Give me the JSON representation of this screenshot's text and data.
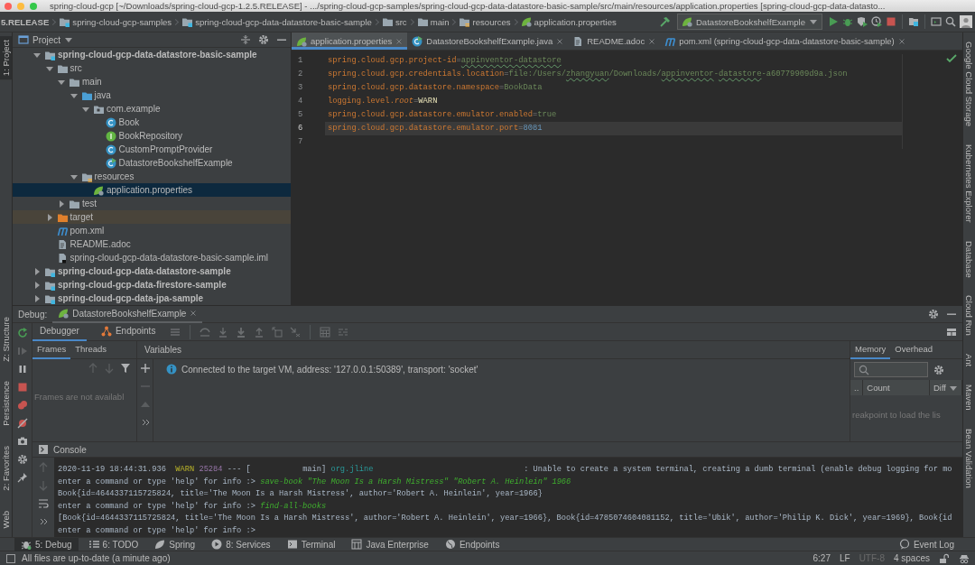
{
  "window": {
    "title": "spring-cloud-gcp [~/Downloads/spring-cloud-gcp-1.2.5.RELEASE] - .../spring-cloud-gcp-samples/spring-cloud-gcp-data-datastore-basic-sample/src/main/resources/application.properties [spring-cloud-gcp-data-datasto..."
  },
  "breadcrumbs": [
    "5.RELEASE",
    "spring-cloud-gcp-samples",
    "spring-cloud-gcp-data-datastore-basic-sample",
    "src",
    "main",
    "resources",
    "application.properties"
  ],
  "run_config": {
    "label": "DatastoreBookshelfExample"
  },
  "left_tool_windows": {
    "top": [
      {
        "label": "1: Project",
        "selected": true
      }
    ],
    "bottom": [
      {
        "label": "Z: Structure",
        "selected": false
      },
      {
        "label": "Persistence",
        "selected": false
      },
      {
        "label": "2: Favorites",
        "selected": false
      },
      {
        "label": "Web",
        "selected": false
      }
    ]
  },
  "right_tool_windows": [
    "Google Cloud Storage",
    "Kubernetes Explorer",
    "Database",
    "Cloud Run",
    "Ant",
    "Maven",
    "Bean Validation"
  ],
  "project_panel": {
    "title": "Project",
    "tree": [
      {
        "label": "spring-cloud-gcp-data-datastore-basic-sample",
        "kind": "module",
        "expanded": true,
        "selected": false,
        "children": [
          {
            "label": "src",
            "kind": "folder",
            "expanded": true,
            "selected": false,
            "children": [
              {
                "label": "main",
                "kind": "folder",
                "expanded": true,
                "selected": false,
                "children": [
                  {
                    "label": "java",
                    "kind": "source",
                    "expanded": true,
                    "selected": false,
                    "children": [
                      {
                        "label": "com.example",
                        "kind": "package",
                        "expanded": true,
                        "selected": false,
                        "children": [
                          {
                            "label": "Book",
                            "kind": "class",
                            "selected": false
                          },
                          {
                            "label": "BookRepository",
                            "kind": "interface",
                            "selected": false
                          },
                          {
                            "label": "CustomPromptProvider",
                            "kind": "class",
                            "selected": false
                          },
                          {
                            "label": "DatastoreBookshelfExample",
                            "kind": "main",
                            "selected": false
                          }
                        ]
                      }
                    ]
                  },
                  {
                    "label": "resources",
                    "kind": "resources",
                    "expanded": true,
                    "selected": false,
                    "children": [
                      {
                        "label": "application.properties",
                        "kind": "properties",
                        "selected": true
                      }
                    ]
                  }
                ]
              },
              {
                "label": "test",
                "kind": "folder",
                "expanded": false,
                "selected": false
              }
            ]
          },
          {
            "label": "target",
            "kind": "excluded",
            "expanded": false,
            "selected": false
          },
          {
            "label": "pom.xml",
            "kind": "maven",
            "selected": false
          },
          {
            "label": "README.adoc",
            "kind": "file",
            "selected": false
          },
          {
            "label": "spring-cloud-gcp-data-datastore-basic-sample.iml",
            "kind": "iml",
            "selected": false
          }
        ]
      },
      {
        "label": "spring-cloud-gcp-data-datastore-sample",
        "kind": "module",
        "expanded": false,
        "selected": false
      },
      {
        "label": "spring-cloud-gcp-data-firestore-sample",
        "kind": "module",
        "expanded": false,
        "selected": false
      },
      {
        "label": "spring-cloud-gcp-data-jpa-sample",
        "kind": "module",
        "expanded": false,
        "selected": false
      }
    ]
  },
  "editor": {
    "tabs": [
      {
        "label": "application.properties",
        "selected": true
      },
      {
        "label": "DatastoreBookshelfExample.java",
        "selected": false
      },
      {
        "label": "README.adoc",
        "selected": false
      },
      {
        "label": "pom.xml (spring-cloud-gcp-data-datastore-basic-sample)",
        "selected": false
      }
    ],
    "lines": [
      {
        "number": "1",
        "current": false,
        "segments": [
          {
            "kind": "key",
            "text": "spring.cloud.gcp.project-id"
          },
          {
            "kind": "sep",
            "text": "="
          },
          {
            "kind": "typo",
            "text": "appinventor-datastore"
          }
        ]
      },
      {
        "number": "2",
        "current": false,
        "segments": [
          {
            "kind": "key",
            "text": "spring.cloud.gcp.credentials.location"
          },
          {
            "kind": "sep",
            "text": "="
          },
          {
            "kind": "value",
            "text": "file:/Users/"
          },
          {
            "kind": "typo",
            "text": "zhangyuan"
          },
          {
            "kind": "value",
            "text": "/Downloads/"
          },
          {
            "kind": "typo",
            "text": "appinventor"
          },
          {
            "kind": "value",
            "text": "-"
          },
          {
            "kind": "typo",
            "text": "datastore"
          },
          {
            "kind": "value",
            "text": "-a60779909d9a.json"
          }
        ]
      },
      {
        "number": "3",
        "current": false,
        "segments": [
          {
            "kind": "key",
            "text": "spring.cloud.gcp.datastore.namespace"
          },
          {
            "kind": "sep",
            "text": "="
          },
          {
            "kind": "value",
            "text": "BookData"
          }
        ]
      },
      {
        "number": "4",
        "current": false,
        "segments": [
          {
            "kind": "key",
            "text": "logging.level."
          },
          {
            "kind": "italic",
            "text": "root"
          },
          {
            "kind": "sep",
            "text": "="
          },
          {
            "kind": "text",
            "text": "WARN"
          }
        ]
      },
      {
        "number": "5",
        "current": false,
        "segments": [
          {
            "kind": "key",
            "text": "spring.cloud.gcp.datastore.emulator.enabled"
          },
          {
            "kind": "sep",
            "text": "="
          },
          {
            "kind": "value",
            "text": "true"
          }
        ]
      },
      {
        "number": "6",
        "current": true,
        "segments": [
          {
            "kind": "key",
            "text": "spring.cloud.gcp.datastore.emulator.port"
          },
          {
            "kind": "sep",
            "text": "="
          },
          {
            "kind": "number",
            "text": "8081"
          }
        ]
      },
      {
        "number": "7",
        "current": false
      }
    ]
  },
  "debug": {
    "label": "Debug:",
    "session": "DatastoreBookshelfExample",
    "tabs": [
      {
        "label": "Debugger",
        "selected": true
      },
      {
        "label": "Endpoints",
        "selected": false
      }
    ],
    "frames_tabs": [
      {
        "label": "Frames",
        "selected": true
      },
      {
        "label": "Threads",
        "selected": false
      }
    ],
    "frames_message": "Frames are not availabl",
    "variables_title": "Variables",
    "variables_message": "Connected to the target VM, address: '127.0.0.1:50389', transport: 'socket'",
    "memory_tabs": [
      {
        "label": "Memory",
        "selected": true
      },
      {
        "label": "Overhead",
        "selected": false
      }
    ],
    "memory_columns": [
      "..",
      "Count",
      "Diff"
    ],
    "memory_message": "reakpoint to load the lis",
    "console_title": "Console",
    "console_lines": [
      [
        {
          "kind": "plain",
          "text": "2020-11-19 18:44:31.936  "
        },
        {
          "kind": "warn",
          "text": "WARN "
        },
        {
          "kind": "pid",
          "text": "25284"
        },
        {
          "kind": "plain",
          "text": " --- [           main] "
        },
        {
          "kind": "logger",
          "text": "org.jline"
        },
        {
          "kind": "plain",
          "text": "                                : Unable to create a system terminal, creating a dumb terminal (enable debug logging for mo"
        }
      ],
      [
        {
          "kind": "plain",
          "text": "enter a command or type 'help' for info :> "
        },
        {
          "kind": "input",
          "text": "save-book \"The Moon Is a Harsh Mistress\" \"Robert A. Heinlein\" 1966"
        }
      ],
      [
        {
          "kind": "plain",
          "text": "Book{id=4644337115725824, title='The Moon Is a Harsh Mistress', author='Robert A. Heinlein', year=1966}"
        }
      ],
      [
        {
          "kind": "plain",
          "text": "enter a command or type 'help' for info :> "
        },
        {
          "kind": "input",
          "text": "find-all-books"
        }
      ],
      [
        {
          "kind": "plain",
          "text": "[Book{id=4644337115725824, title='The Moon Is a Harsh Mistress', author='Robert A. Heinlein', year=1966}, Book{id=4785074604081152, title='Ubik', author='Philip K. Dick', year=1969}, Book{id"
        }
      ],
      [
        {
          "kind": "plain",
          "text": "enter a command or type 'help' for info :>"
        }
      ]
    ]
  },
  "bottom_tabs": [
    {
      "label": "5: Debug",
      "selected": true
    },
    {
      "label": "6: TODO",
      "selected": false
    },
    {
      "label": "Spring",
      "selected": false
    },
    {
      "label": "8: Services",
      "selected": false
    },
    {
      "label": "Terminal",
      "selected": false
    },
    {
      "label": "Java Enterprise",
      "selected": false
    },
    {
      "label": "Endpoints",
      "selected": false
    }
  ],
  "event_log": "Event Log",
  "status": {
    "message": "All files are up-to-date (a minute ago)",
    "items": [
      {
        "text": "6:27",
        "disabled": false
      },
      {
        "text": "LF",
        "disabled": false
      },
      {
        "text": "UTF-8",
        "disabled": true
      },
      {
        "text": "4 spaces",
        "disabled": false
      }
    ]
  }
}
